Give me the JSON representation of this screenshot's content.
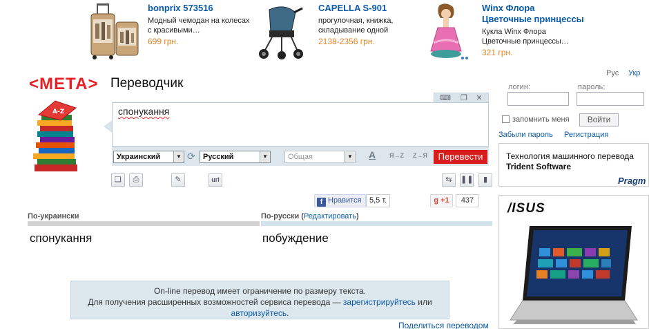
{
  "ads": [
    {
      "title": "bonprix 573516",
      "desc_line1": "Модный чемодан на колесах",
      "desc_line2": "с красивыми…",
      "price": "699 грн."
    },
    {
      "title": "CAPELLA S-901",
      "desc_line1": "прогулочная, книжка,",
      "desc_line2": "складывание одной",
      "price": "2138-2356 грн."
    },
    {
      "title_line1": "Winx Флора",
      "title_line2": "Цветочные принцессы",
      "desc_line1": "Кукла Winx Флора",
      "desc_line2": "Цветочные принцессы…",
      "price": "321 грн."
    }
  ],
  "header": {
    "logo_text": "МЕТА",
    "title": "Переводчик",
    "lang_rus": "Рус",
    "lang_ukr": "Укр"
  },
  "translator": {
    "source_text": "спонукання",
    "source_lang": "Украинский",
    "target_lang": "Русский",
    "topic": "Общая",
    "case_az": "Я→Z",
    "case_za": "Z→Я",
    "translate_label": "Перевести",
    "url_label": "url"
  },
  "social": {
    "fb_label": "Нравится",
    "fb_count": "5,5 т.",
    "gplus_label": "+1",
    "gplus_count": "437"
  },
  "result": {
    "left_header": "По-украински",
    "right_header": "По-русски",
    "edit_link": "Редактировать",
    "left_text": "спонукання",
    "right_text": "побуждение"
  },
  "notice": {
    "line1": "On-line перевод имеет ограничение по размеру текста.",
    "line2_prefix": "Для получения расширенных возможностей сервиса перевода — ",
    "register_link": "зарегистрируйтесь",
    "or_text": " или",
    "login_link": "авторизуйтесь",
    "end": "."
  },
  "share_link": "Поделиться переводом",
  "sidebar": {
    "login_label": "логин:",
    "password_label": "пароль:",
    "remember_label": "запомнить меня",
    "login_button": "Войти",
    "forgot_link": "Забыли пароль",
    "register_link": "Регистрация",
    "mt_ad_line1": "Технология машинного перевода",
    "mt_ad_company": "Trident Software",
    "mt_ad_logo": "Pragm",
    "asus_logo": "/ISUS"
  },
  "colors": {
    "brand_red": "#e52125",
    "link_blue": "#0b5aa7",
    "price_orange": "#e8811c",
    "translate_button": "#d91d1d"
  }
}
